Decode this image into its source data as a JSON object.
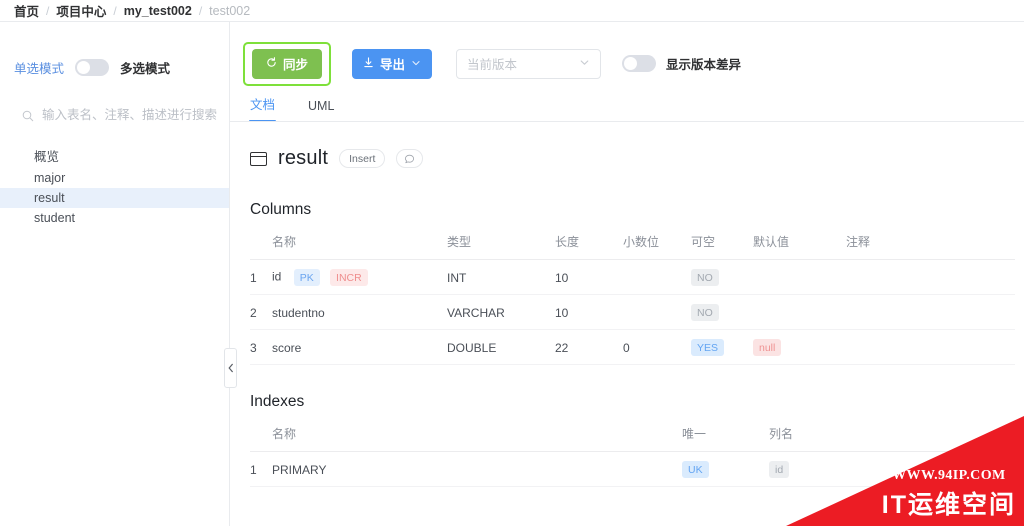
{
  "breadcrumb": {
    "items": [
      {
        "label": "首页",
        "muted": false
      },
      {
        "label": "项目中心",
        "muted": false
      },
      {
        "label": "my_test002",
        "muted": false
      },
      {
        "label": "test002",
        "muted": true
      }
    ],
    "separator": "/"
  },
  "sidebar": {
    "mode": {
      "single_label": "单选模式",
      "multi_label": "多选模式",
      "toggle_state": "off"
    },
    "search": {
      "placeholder": "输入表名、注释、描述进行搜索",
      "value": ""
    },
    "tree": [
      {
        "label": "概览",
        "selected": false
      },
      {
        "label": "major",
        "selected": false
      },
      {
        "label": "result",
        "selected": true
      },
      {
        "label": "student",
        "selected": false
      }
    ],
    "collapse_handle": "‹"
  },
  "toolbar": {
    "sync_label": "同步",
    "export_label": "导出",
    "version_select_placeholder": "当前版本",
    "diff_toggle_label": "显示版本差异",
    "diff_toggle_state": "off",
    "sync_focused": true,
    "colors": {
      "sync_bg": "#7ec050",
      "export_bg": "#4b94f2",
      "focus_ring": "#7ee03a"
    }
  },
  "tabs": [
    {
      "label": "文档",
      "active": true
    },
    {
      "label": "UML",
      "active": false
    }
  ],
  "doc": {
    "table_name": "result",
    "insert_tag": "Insert",
    "comment_icon": "comment-icon",
    "columns_heading": "Columns",
    "columns_headers": [
      "",
      "名称",
      "类型",
      "长度",
      "小数位",
      "可空",
      "默认值",
      "注释"
    ],
    "columns_rows": [
      {
        "index": "1",
        "name": "id",
        "tags": [
          {
            "text": "PK",
            "style": "pk"
          },
          {
            "text": "INCR",
            "style": "incr"
          }
        ],
        "type": "INT",
        "length": "10",
        "decimals": "",
        "nullable": "NO",
        "nullable_style": "gray",
        "default": "",
        "default_style": "",
        "comment": ""
      },
      {
        "index": "2",
        "name": "studentno",
        "tags": [],
        "type": "VARCHAR",
        "length": "10",
        "decimals": "",
        "nullable": "NO",
        "nullable_style": "gray",
        "default": "",
        "default_style": "",
        "comment": ""
      },
      {
        "index": "3",
        "name": "score",
        "tags": [],
        "type": "DOUBLE",
        "length": "22",
        "decimals": "0",
        "nullable": "YES",
        "nullable_style": "blue",
        "default": "null",
        "default_style": "red",
        "comment": ""
      }
    ],
    "indexes_heading": "Indexes",
    "indexes_headers": [
      "",
      "名称",
      "唯一",
      "列名"
    ],
    "indexes_rows": [
      {
        "index": "1",
        "name": "PRIMARY",
        "unique": "UK",
        "unique_style": "blue",
        "column": "id",
        "column_style": "gray"
      }
    ]
  },
  "watermark": {
    "url": "WWW.94IP.COM",
    "brand": "IT运维空间",
    "color": "#ec1c24"
  }
}
